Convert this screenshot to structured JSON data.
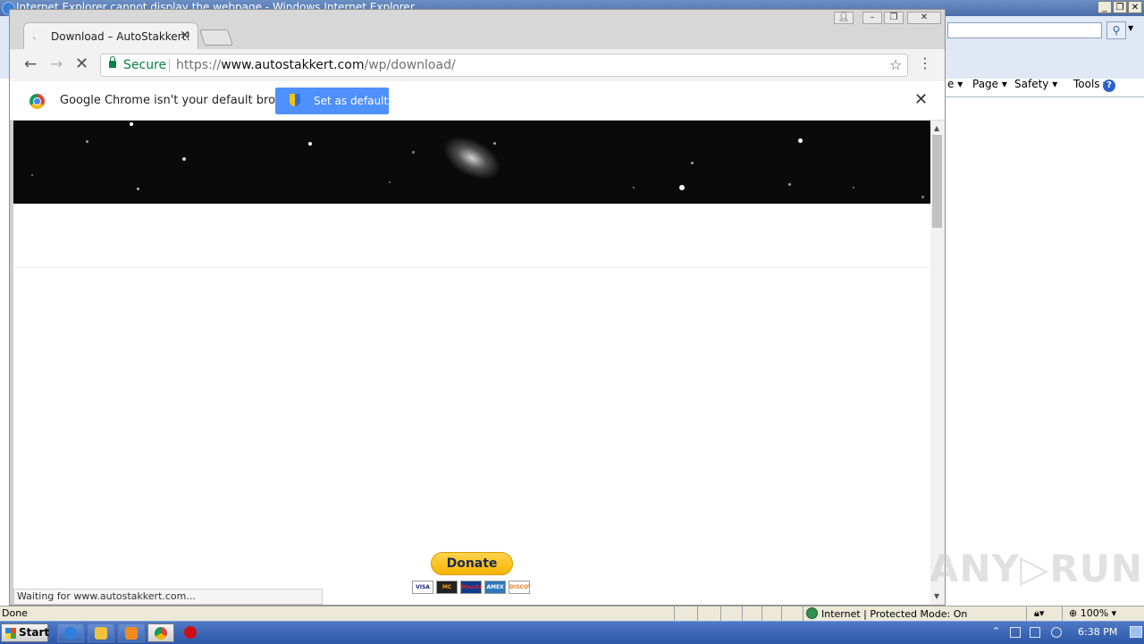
{
  "ie": {
    "title": "Internet Explorer cannot display the webpage - Windows Internet Explorer",
    "command_bar": {
      "page": "Page ▾",
      "safety": "Safety ▾",
      "tools": "Tools ▾",
      "help": "?",
      "partial": "e ▾"
    },
    "status": {
      "done": "Done",
      "zone": "Internet | Protected Mode: On",
      "zoom": "100%"
    }
  },
  "chrome": {
    "tab": {
      "title": "Download – AutoStakkert!",
      "close": "✕"
    },
    "toolbar": {
      "secure_label": "Secure",
      "url_scheme": "https://",
      "url_host": "www.autostakkert.com",
      "url_path": "/wp/download/"
    },
    "infobar": {
      "message": "Google Chrome isn't your default browser",
      "button_label": "Set as default",
      "close": "✕"
    },
    "status_text": "Waiting for www.autostakkert.com..."
  },
  "page": {
    "donate_label": "Donate",
    "cards": [
      "VISA",
      "MC",
      "Maestro",
      "AMEX",
      "DISCOVER"
    ]
  },
  "watermark": "ANY▷RUN",
  "taskbar": {
    "start_label": "Start",
    "clock": "6:38 PM",
    "pinned": [
      "internet-explorer",
      "explorer",
      "media-player",
      "chrome",
      "opera"
    ]
  },
  "colors": {
    "accent_button": "#4d90fe",
    "secure_green": "#0b8043",
    "taskbar_blue": "#2d58a8",
    "donate_yellow": "#f7b500"
  }
}
